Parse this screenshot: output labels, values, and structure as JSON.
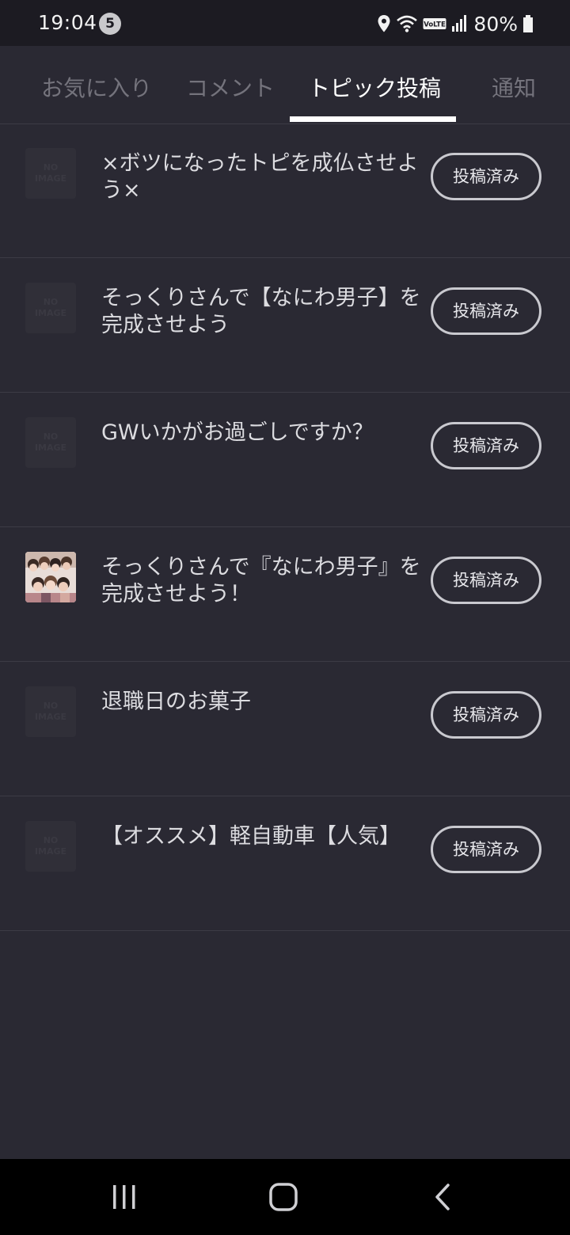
{
  "status_bar": {
    "time": "19:04",
    "notification_count": "5",
    "battery": "80%"
  },
  "tabs": [
    {
      "label": "お気に入り",
      "active": false
    },
    {
      "label": "コメント",
      "active": false
    },
    {
      "label": "トピック投稿",
      "active": true
    },
    {
      "label": "通知",
      "active": false
    }
  ],
  "topics": [
    {
      "title": "×ボツになったトピを成仏させよう×",
      "thumbnail": "no-image",
      "button": "投稿済み"
    },
    {
      "title": "そっくりさんで【なにわ男子】を完成させよう",
      "thumbnail": "no-image",
      "button": "投稿済み"
    },
    {
      "title": "GWいかがお過ごしですか？",
      "thumbnail": "no-image",
      "button": "投稿済み"
    },
    {
      "title": "そっくりさんで『なにわ男子』を完成させよう！",
      "thumbnail": "photo",
      "button": "投稿済み"
    },
    {
      "title": "退職日のお菓子",
      "thumbnail": "no-image",
      "button": "投稿済み"
    },
    {
      "title": "【オススメ】軽自動車【人気】",
      "thumbnail": "no-image",
      "button": "投稿済み"
    }
  ],
  "no_image_text": [
    "NO",
    "IMAGE"
  ],
  "icons": {
    "location": "location-pin-icon",
    "wifi": "wifi-icon",
    "volte": "volte-icon",
    "signal": "signal-icon",
    "battery": "battery-icon",
    "recents": "recents-icon",
    "home": "home-icon",
    "back": "back-icon"
  },
  "volte_label": "VoLTE",
  "colors": {
    "background": "#2a2933",
    "status_bar": "#1c1b22",
    "active_tab": "#ffffff",
    "inactive_tab": "#74737c"
  }
}
